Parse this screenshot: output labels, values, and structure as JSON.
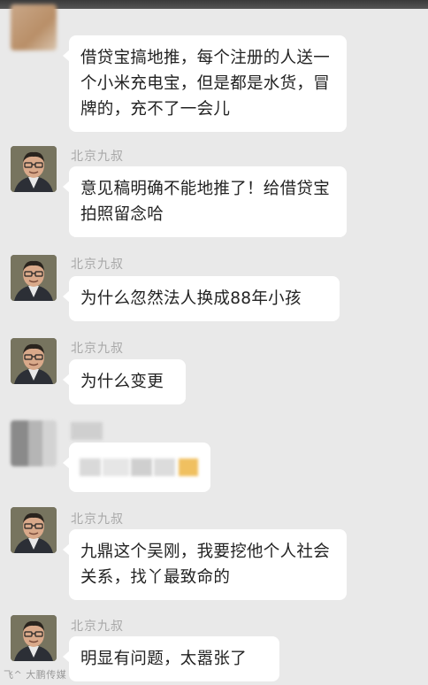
{
  "chat": {
    "messages": [
      {
        "sender": "",
        "text": "借贷宝搞地推，每个注册的人送一个小米充电宝，但是都是水货，冒牌的，充不了一会儿"
      },
      {
        "sender": "北京九叔",
        "text": "意见稿明确不能地推了！给借贷宝拍照留念哈"
      },
      {
        "sender": "北京九叔",
        "text": "为什么忽然法人换成88年小孩"
      },
      {
        "sender": "北京九叔",
        "text": "为什么变更"
      },
      {
        "sender": "",
        "text": ""
      },
      {
        "sender": "北京九叔",
        "text": "九鼎这个吴刚，我要挖他个人社会关系，找丫最致命的"
      },
      {
        "sender": "北京九叔",
        "text": "明显有问题，太嚣张了"
      }
    ]
  },
  "watermark": "飞^ 大鹏传媒",
  "colors": {
    "background": "#e9e9e9",
    "bubble": "#ffffff",
    "name": "#a8a8a8"
  },
  "icons": {
    "avatar": "man-with-glasses-avatar"
  }
}
